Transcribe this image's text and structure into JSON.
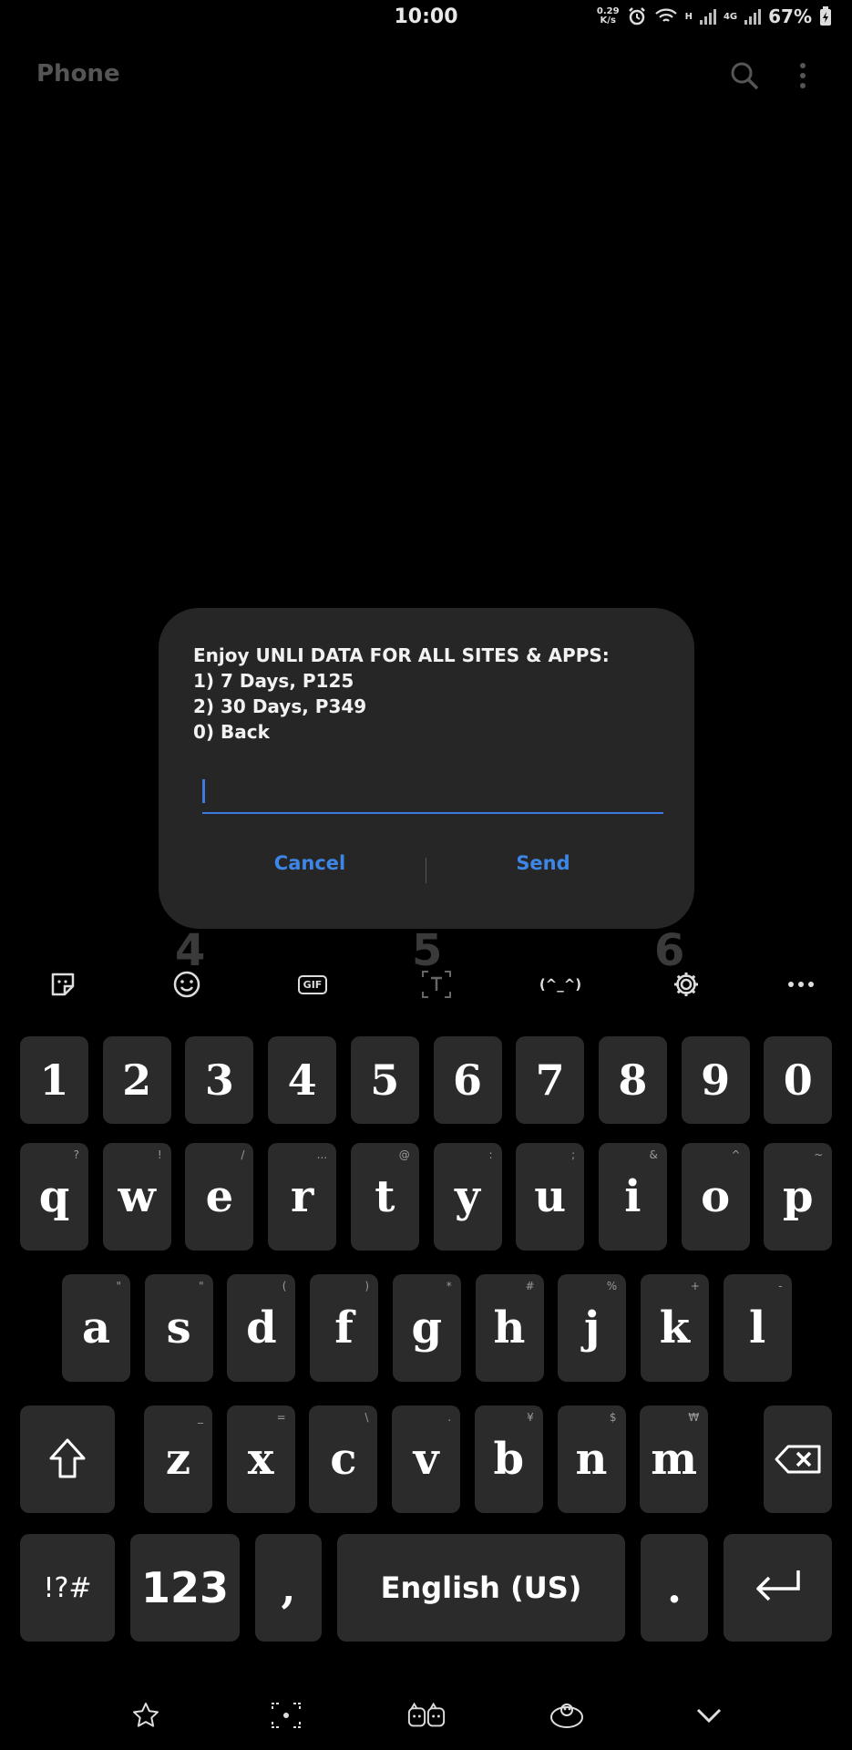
{
  "status_bar": {
    "time": "10:00",
    "net_speed_value": "0.29",
    "net_speed_unit": "K/s",
    "network_h": "H",
    "network_4g": "4G",
    "battery": "67%"
  },
  "app": {
    "title": "Phone"
  },
  "dialpad_hints": [
    "4",
    "5",
    "6"
  ],
  "dialog": {
    "message": "Enjoy UNLI DATA FOR ALL SITES & APPS:\n1) 7 Days, P125\n2) 30 Days, P349\n0) Back",
    "input_value": "",
    "cancel_label": "Cancel",
    "send_label": "Send"
  },
  "keyboard": {
    "toolbar": {
      "gif_label": "GIF",
      "kaomoji_label": "(^_^)"
    },
    "numbers": [
      "1",
      "2",
      "3",
      "4",
      "5",
      "6",
      "7",
      "8",
      "9",
      "0"
    ],
    "row1": [
      {
        "key": "q",
        "hint": "?"
      },
      {
        "key": "w",
        "hint": "!"
      },
      {
        "key": "e",
        "hint": "/"
      },
      {
        "key": "r",
        "hint": "..."
      },
      {
        "key": "t",
        "hint": "@"
      },
      {
        "key": "y",
        "hint": ":"
      },
      {
        "key": "u",
        "hint": ";"
      },
      {
        "key": "i",
        "hint": "&"
      },
      {
        "key": "o",
        "hint": "^"
      },
      {
        "key": "p",
        "hint": "~"
      }
    ],
    "row2": [
      {
        "key": "a",
        "hint": "\""
      },
      {
        "key": "s",
        "hint": "\""
      },
      {
        "key": "d",
        "hint": "("
      },
      {
        "key": "f",
        "hint": ")"
      },
      {
        "key": "g",
        "hint": "*"
      },
      {
        "key": "h",
        "hint": "#"
      },
      {
        "key": "j",
        "hint": "%"
      },
      {
        "key": "k",
        "hint": "+"
      },
      {
        "key": "l",
        "hint": "-"
      }
    ],
    "row3": [
      {
        "key": "z",
        "hint": "_"
      },
      {
        "key": "x",
        "hint": "="
      },
      {
        "key": "c",
        "hint": "\\"
      },
      {
        "key": "v",
        "hint": "."
      },
      {
        "key": "b",
        "hint": "¥"
      },
      {
        "key": "n",
        "hint": "$"
      },
      {
        "key": "m",
        "hint": "₩"
      }
    ],
    "symbols_label": "!?#",
    "numbers_label": "123",
    "comma_label": ",",
    "space_label": "English (US)",
    "period_label": "."
  },
  "colors": {
    "accent": "#3d86e6",
    "dialog_bg": "#262626",
    "key_bg": "#2b2b2b"
  }
}
